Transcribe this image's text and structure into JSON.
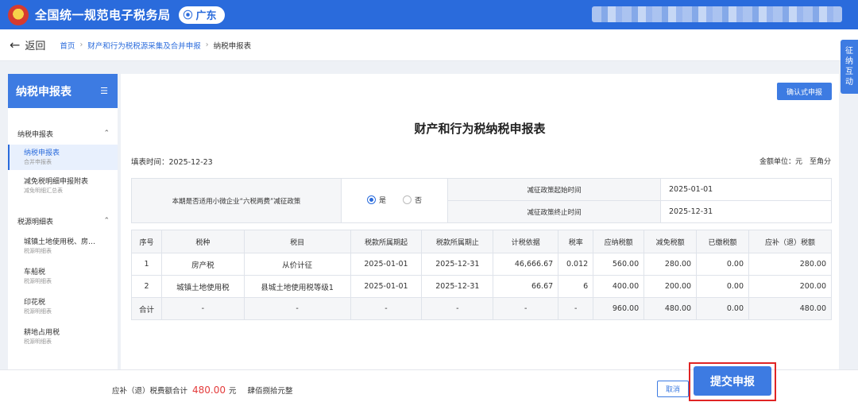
{
  "header": {
    "title": "全国统一规范电子税务局",
    "region": "广东",
    "emblem_icon": "national-emblem-icon",
    "region_icon": "location-pin-icon"
  },
  "breadcrumb": {
    "back_label": "返回",
    "items": [
      "首页",
      "财产和行为税税源采集及合并申报",
      "纳税申报表"
    ]
  },
  "float_tab": [
    "征",
    "纳",
    "互",
    "动"
  ],
  "sidebar": {
    "title": "纳税申报表",
    "groups": [
      {
        "label": "纳税申报表",
        "chevron": "^"
      },
      {
        "label": "税源明细表",
        "chevron": "^"
      }
    ],
    "items": [
      {
        "name": "纳税申报表",
        "sub": "合并申报表"
      },
      {
        "name": "减免税明细申报附表",
        "sub": "减免明细汇总表"
      },
      {
        "name": "城镇土地使用税、房…",
        "sub": "税源明细表"
      },
      {
        "name": "车船税",
        "sub": "税源明细表"
      },
      {
        "name": "印花税",
        "sub": "税源明细表"
      },
      {
        "name": "耕地占用税",
        "sub": "税源明细表"
      }
    ]
  },
  "main": {
    "confirm_label": "确认式申报",
    "form_title": "财产和行为税纳税申报表",
    "fill_date": "填表时间：2025-12-23",
    "unit": "金额单位：元　至角分"
  },
  "policy": {
    "question": "本期是否适用小微企业“六税两费”减征政策",
    "yes": "是",
    "no": "否",
    "selected": "是",
    "start_label": "减征政策起始时间",
    "start_value": "2025-01-01",
    "end_label": "减征政策终止时间",
    "end_value": "2025-12-31"
  },
  "tax_table": {
    "headers": [
      "序号",
      "税种",
      "税目",
      "税款所属期起",
      "税款所属期止",
      "计税依据",
      "税率",
      "应纳税额",
      "减免税额",
      "已缴税额",
      "应补（退）税额"
    ],
    "rows": [
      [
        "1",
        "房产税",
        "从价计征",
        "2025-01-01",
        "2025-12-31",
        "46,666.67",
        "0.012",
        "560.00",
        "280.00",
        "0.00",
        "280.00"
      ],
      [
        "2",
        "城镇土地使用税",
        "县城土地使用税等级1",
        "2025-01-01",
        "2025-12-31",
        "66.67",
        "6",
        "400.00",
        "200.00",
        "0.00",
        "200.00"
      ],
      [
        "合计",
        "-",
        "-",
        "-",
        "-",
        "-",
        "-",
        "960.00",
        "480.00",
        "0.00",
        "480.00"
      ]
    ]
  },
  "footer": {
    "sum_label": "应补（退）税费额合计",
    "sum_amount": "480.00",
    "sum_unit": "元",
    "sum_capital": "肆佰捌拾元整",
    "cancel_label": "取消",
    "submit_label": "提交申报"
  }
}
